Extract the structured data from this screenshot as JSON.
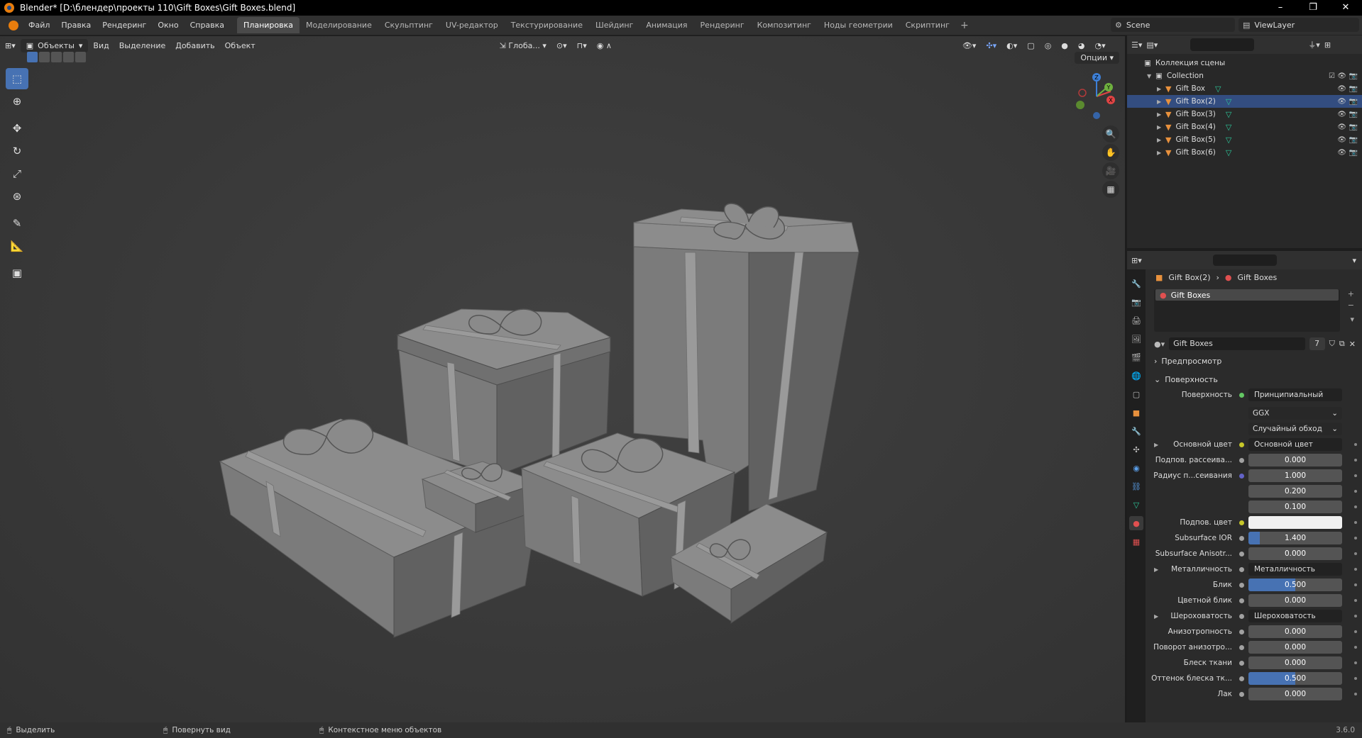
{
  "window": {
    "title": "Blender* [D:\\блендер\\проекты 110\\Gift Boxes\\Gift Boxes.blend]",
    "controls": [
      "–",
      "❐",
      "✕"
    ]
  },
  "menu": [
    "Файл",
    "Правка",
    "Рендеринг",
    "Окно",
    "Справка"
  ],
  "workspaces": [
    "Планировка",
    "Моделирование",
    "Скульптинг",
    "UV-редактор",
    "Текстурирование",
    "Шейдинг",
    "Анимация",
    "Рендеринг",
    "Композитинг",
    "Ноды геометрии",
    "Скриптинг"
  ],
  "active_workspace": "Планировка",
  "scene": "Scene",
  "view_layer": "ViewLayer",
  "viewport": {
    "mode": "Объекты",
    "menus": [
      "Вид",
      "Выделение",
      "Добавить",
      "Объект"
    ],
    "orientation": "Глоба...",
    "options": "Опции",
    "gizmo_axes": {
      "x": "X",
      "y": "Y",
      "z": "Z"
    }
  },
  "outliner": {
    "root": "Коллекция сцены",
    "collection": "Collection",
    "objects": [
      "Gift Box",
      "Gift Box(2)",
      "Gift Box(3)",
      "Gift Box(4)",
      "Gift Box(5)",
      "Gift Box(6)"
    ],
    "selected": "Gift Box(2)"
  },
  "properties": {
    "breadcrumb_object": "Gift Box(2)",
    "breadcrumb_material": "Gift Boxes",
    "material_slot": "Gift Boxes",
    "material_name": "Gift Boxes",
    "material_users": "7",
    "sections": {
      "preview": "Предпросмотр",
      "surface": "Поверхность"
    },
    "surface_label": "Поверхность",
    "surface_value": "Принципиальный BSDF",
    "distribution": "GGX",
    "subsurface_method": "Случайный обход",
    "rows": [
      {
        "label": "Основной цвет",
        "value": "Основной цвет",
        "kind": "link",
        "dot": "y"
      },
      {
        "label": "Подпов. рассеива...",
        "value": "0.000",
        "kind": "num",
        "dot": "gr",
        "fill": 0
      },
      {
        "label": "Радиус п...сеивания",
        "value": "1.000",
        "kind": "num",
        "dot": "p",
        "fill": 0
      },
      {
        "label": "",
        "value": "0.200",
        "kind": "num",
        "fill": 0
      },
      {
        "label": "",
        "value": "0.100",
        "kind": "num",
        "fill": 0
      },
      {
        "label": "Подпов. цвет",
        "value": "",
        "kind": "color",
        "dot": "y"
      },
      {
        "label": "Subsurface IOR",
        "value": "1.400",
        "kind": "num",
        "dot": "gr",
        "fill": 0.12
      },
      {
        "label": "Subsurface Anisotr...",
        "value": "0.000",
        "kind": "num",
        "dot": "gr",
        "fill": 0
      },
      {
        "label": "Металличность",
        "value": "Металличность",
        "kind": "link",
        "dot": "gr"
      },
      {
        "label": "Блик",
        "value": "0.500",
        "kind": "num",
        "dot": "gr",
        "fill": 0.5
      },
      {
        "label": "Цветной блик",
        "value": "0.000",
        "kind": "num",
        "dot": "gr",
        "fill": 0
      },
      {
        "label": "Шероховатость",
        "value": "Шероховатость",
        "kind": "link",
        "dot": "gr"
      },
      {
        "label": "Анизотропность",
        "value": "0.000",
        "kind": "num",
        "dot": "gr",
        "fill": 0
      },
      {
        "label": "Поворот анизотро...",
        "value": "0.000",
        "kind": "num",
        "dot": "gr",
        "fill": 0
      },
      {
        "label": "Блеск ткани",
        "value": "0.000",
        "kind": "num",
        "dot": "gr",
        "fill": 0
      },
      {
        "label": "Оттенок блеска тк...",
        "value": "0.500",
        "kind": "num",
        "dot": "gr",
        "fill": 0.5
      },
      {
        "label": "Лак",
        "value": "0.000",
        "kind": "num",
        "dot": "gr",
        "fill": 0
      }
    ]
  },
  "statusbar": {
    "items": [
      "Выделить",
      "Повернуть вид",
      "Контекстное меню объектов"
    ],
    "version": "3.6.0"
  }
}
